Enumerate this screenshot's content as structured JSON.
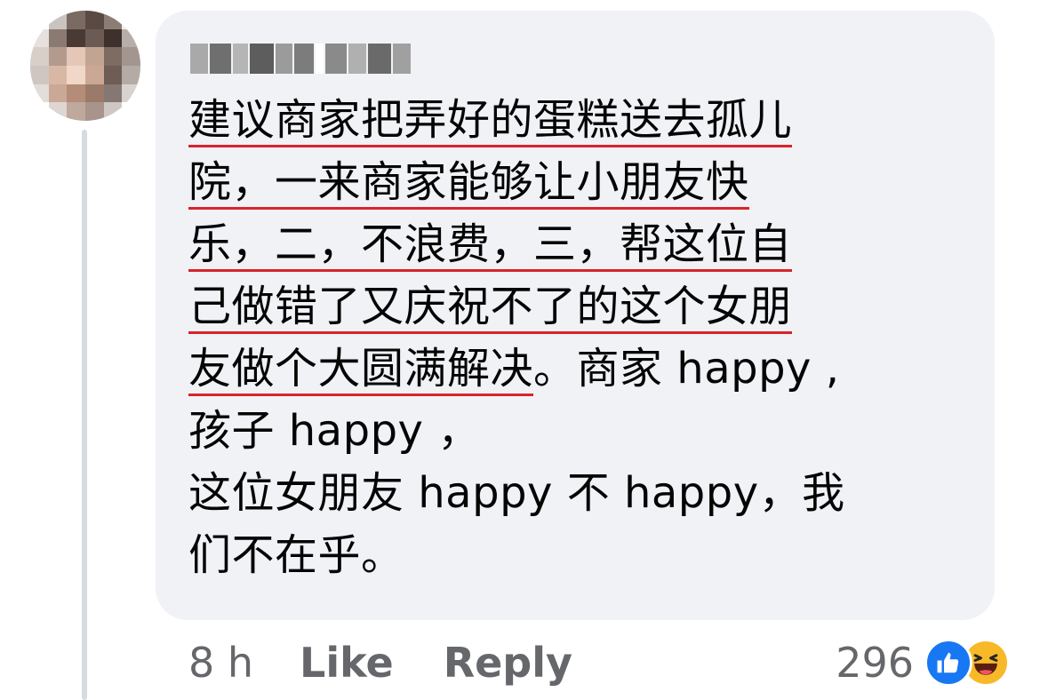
{
  "comment": {
    "lines": [
      {
        "underlined": "建议商家把弄好的蛋糕送去孤儿",
        "rest": ""
      },
      {
        "underlined": "院，一来商家能够让小朋友快",
        "rest": ""
      },
      {
        "underlined": "乐，二，不浪费，三，帮这位自",
        "rest": ""
      },
      {
        "underlined": "己做错了又庆祝不了的这个女朋",
        "rest": ""
      },
      {
        "underlined": "友做个大圆满解决",
        "rest": "。商家 happy ,"
      },
      {
        "underlined": "",
        "rest": "孩子 happy ，"
      },
      {
        "underlined": "",
        "rest": "这位女朋友 happy 不 happy，我"
      },
      {
        "underlined": "",
        "rest": "们不在乎。"
      }
    ]
  },
  "footer": {
    "time": "8 h",
    "like_label": "Like",
    "reply_label": "Reply"
  },
  "reactions": {
    "count": "296",
    "icons": [
      "like-icon",
      "haha-icon"
    ]
  },
  "colors": {
    "bubble": "#f0f2f5",
    "underline": "#d9232a",
    "meta_text": "#65676b",
    "like_blue": "#1877f2",
    "haha_yellow": "#f7b928"
  }
}
